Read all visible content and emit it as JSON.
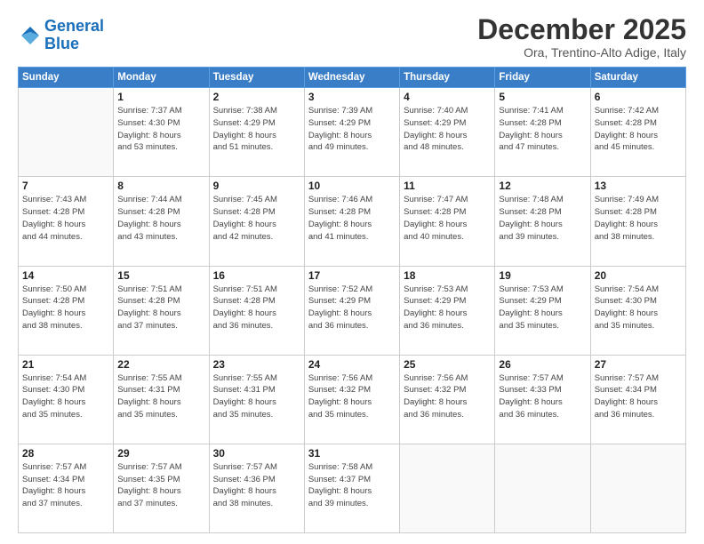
{
  "logo": {
    "line1": "General",
    "line2": "Blue"
  },
  "title": "December 2025",
  "subtitle": "Ora, Trentino-Alto Adige, Italy",
  "days_header": [
    "Sunday",
    "Monday",
    "Tuesday",
    "Wednesday",
    "Thursday",
    "Friday",
    "Saturday"
  ],
  "weeks": [
    [
      {
        "day": "",
        "info": ""
      },
      {
        "day": "1",
        "info": "Sunrise: 7:37 AM\nSunset: 4:30 PM\nDaylight: 8 hours\nand 53 minutes."
      },
      {
        "day": "2",
        "info": "Sunrise: 7:38 AM\nSunset: 4:29 PM\nDaylight: 8 hours\nand 51 minutes."
      },
      {
        "day": "3",
        "info": "Sunrise: 7:39 AM\nSunset: 4:29 PM\nDaylight: 8 hours\nand 49 minutes."
      },
      {
        "day": "4",
        "info": "Sunrise: 7:40 AM\nSunset: 4:29 PM\nDaylight: 8 hours\nand 48 minutes."
      },
      {
        "day": "5",
        "info": "Sunrise: 7:41 AM\nSunset: 4:28 PM\nDaylight: 8 hours\nand 47 minutes."
      },
      {
        "day": "6",
        "info": "Sunrise: 7:42 AM\nSunset: 4:28 PM\nDaylight: 8 hours\nand 45 minutes."
      }
    ],
    [
      {
        "day": "7",
        "info": "Sunrise: 7:43 AM\nSunset: 4:28 PM\nDaylight: 8 hours\nand 44 minutes."
      },
      {
        "day": "8",
        "info": "Sunrise: 7:44 AM\nSunset: 4:28 PM\nDaylight: 8 hours\nand 43 minutes."
      },
      {
        "day": "9",
        "info": "Sunrise: 7:45 AM\nSunset: 4:28 PM\nDaylight: 8 hours\nand 42 minutes."
      },
      {
        "day": "10",
        "info": "Sunrise: 7:46 AM\nSunset: 4:28 PM\nDaylight: 8 hours\nand 41 minutes."
      },
      {
        "day": "11",
        "info": "Sunrise: 7:47 AM\nSunset: 4:28 PM\nDaylight: 8 hours\nand 40 minutes."
      },
      {
        "day": "12",
        "info": "Sunrise: 7:48 AM\nSunset: 4:28 PM\nDaylight: 8 hours\nand 39 minutes."
      },
      {
        "day": "13",
        "info": "Sunrise: 7:49 AM\nSunset: 4:28 PM\nDaylight: 8 hours\nand 38 minutes."
      }
    ],
    [
      {
        "day": "14",
        "info": "Sunrise: 7:50 AM\nSunset: 4:28 PM\nDaylight: 8 hours\nand 38 minutes."
      },
      {
        "day": "15",
        "info": "Sunrise: 7:51 AM\nSunset: 4:28 PM\nDaylight: 8 hours\nand 37 minutes."
      },
      {
        "day": "16",
        "info": "Sunrise: 7:51 AM\nSunset: 4:28 PM\nDaylight: 8 hours\nand 36 minutes."
      },
      {
        "day": "17",
        "info": "Sunrise: 7:52 AM\nSunset: 4:29 PM\nDaylight: 8 hours\nand 36 minutes."
      },
      {
        "day": "18",
        "info": "Sunrise: 7:53 AM\nSunset: 4:29 PM\nDaylight: 8 hours\nand 36 minutes."
      },
      {
        "day": "19",
        "info": "Sunrise: 7:53 AM\nSunset: 4:29 PM\nDaylight: 8 hours\nand 35 minutes."
      },
      {
        "day": "20",
        "info": "Sunrise: 7:54 AM\nSunset: 4:30 PM\nDaylight: 8 hours\nand 35 minutes."
      }
    ],
    [
      {
        "day": "21",
        "info": "Sunrise: 7:54 AM\nSunset: 4:30 PM\nDaylight: 8 hours\nand 35 minutes."
      },
      {
        "day": "22",
        "info": "Sunrise: 7:55 AM\nSunset: 4:31 PM\nDaylight: 8 hours\nand 35 minutes."
      },
      {
        "day": "23",
        "info": "Sunrise: 7:55 AM\nSunset: 4:31 PM\nDaylight: 8 hours\nand 35 minutes."
      },
      {
        "day": "24",
        "info": "Sunrise: 7:56 AM\nSunset: 4:32 PM\nDaylight: 8 hours\nand 35 minutes."
      },
      {
        "day": "25",
        "info": "Sunrise: 7:56 AM\nSunset: 4:32 PM\nDaylight: 8 hours\nand 36 minutes."
      },
      {
        "day": "26",
        "info": "Sunrise: 7:57 AM\nSunset: 4:33 PM\nDaylight: 8 hours\nand 36 minutes."
      },
      {
        "day": "27",
        "info": "Sunrise: 7:57 AM\nSunset: 4:34 PM\nDaylight: 8 hours\nand 36 minutes."
      }
    ],
    [
      {
        "day": "28",
        "info": "Sunrise: 7:57 AM\nSunset: 4:34 PM\nDaylight: 8 hours\nand 37 minutes."
      },
      {
        "day": "29",
        "info": "Sunrise: 7:57 AM\nSunset: 4:35 PM\nDaylight: 8 hours\nand 37 minutes."
      },
      {
        "day": "30",
        "info": "Sunrise: 7:57 AM\nSunset: 4:36 PM\nDaylight: 8 hours\nand 38 minutes."
      },
      {
        "day": "31",
        "info": "Sunrise: 7:58 AM\nSunset: 4:37 PM\nDaylight: 8 hours\nand 39 minutes."
      },
      {
        "day": "",
        "info": ""
      },
      {
        "day": "",
        "info": ""
      },
      {
        "day": "",
        "info": ""
      }
    ]
  ]
}
